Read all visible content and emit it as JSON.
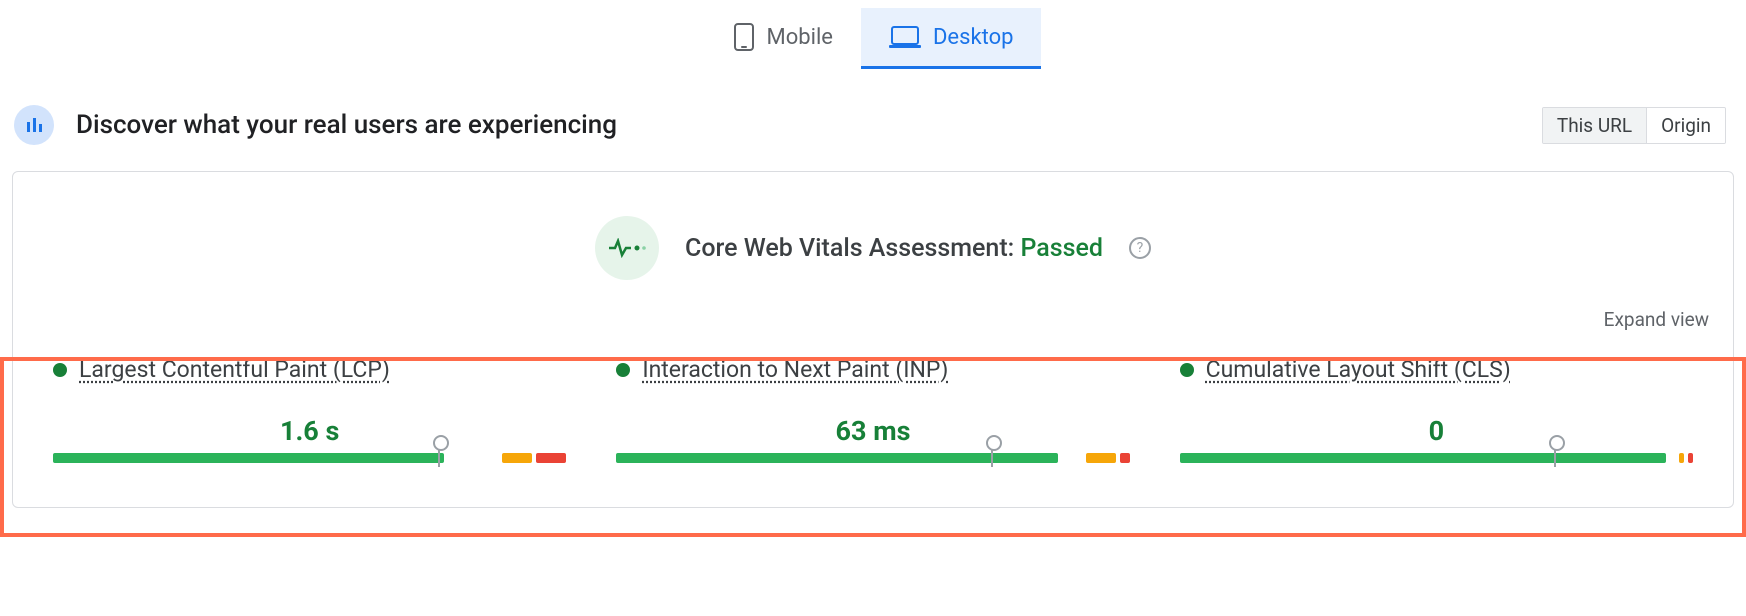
{
  "tabs": {
    "mobile": "Mobile",
    "desktop": "Desktop"
  },
  "header": {
    "title": "Discover what your real users are experiencing",
    "scope_this_url": "This URL",
    "scope_origin": "Origin"
  },
  "assessment": {
    "prefix": "Core Web Vitals Assessment:",
    "status": "Passed",
    "help": "?",
    "expand_view": "Expand view"
  },
  "metrics": [
    {
      "name": "Largest Contentful Paint (LCP)",
      "value": "1.6 s",
      "dist": {
        "green": 78,
        "orange": 6,
        "red": 6,
        "gap": 10
      },
      "marker_pct": 75
    },
    {
      "name": "Interaction to Next Paint (INP)",
      "value": "63 ms",
      "dist": {
        "green": 88,
        "orange": 6,
        "red": 2,
        "gap": 4
      },
      "marker_pct": 73
    },
    {
      "name": "Cumulative Layout Shift (CLS)",
      "value": "0",
      "dist": {
        "green": 97,
        "orange": 1,
        "red": 1,
        "gap": 1
      },
      "marker_pct": 73
    }
  ],
  "colors": {
    "green": "#2bb35a",
    "orange": "#f6a609",
    "red": "#ea4335",
    "accent_blue": "#1a73e8"
  }
}
